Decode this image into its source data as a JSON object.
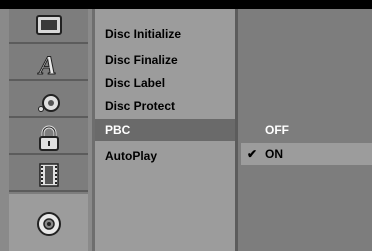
{
  "sidebar": {
    "icons": [
      {
        "name": "monitor-icon"
      },
      {
        "name": "language-icon",
        "glyph": "A"
      },
      {
        "name": "audio-icon"
      },
      {
        "name": "lock-icon"
      },
      {
        "name": "film-icon"
      },
      {
        "name": "disc-icon"
      }
    ],
    "selected_index": 5
  },
  "menu": {
    "items": [
      {
        "label": "Disc Initialize"
      },
      {
        "label": "Disc Finalize"
      },
      {
        "label": "Disc Label"
      },
      {
        "label": "Disc Protect"
      },
      {
        "label": "PBC"
      },
      {
        "label": "AutoPlay"
      }
    ],
    "active_index": 4
  },
  "options": {
    "items": [
      {
        "label": "OFF"
      },
      {
        "label": "ON",
        "check": "✔"
      }
    ],
    "selected_index": 1
  }
}
